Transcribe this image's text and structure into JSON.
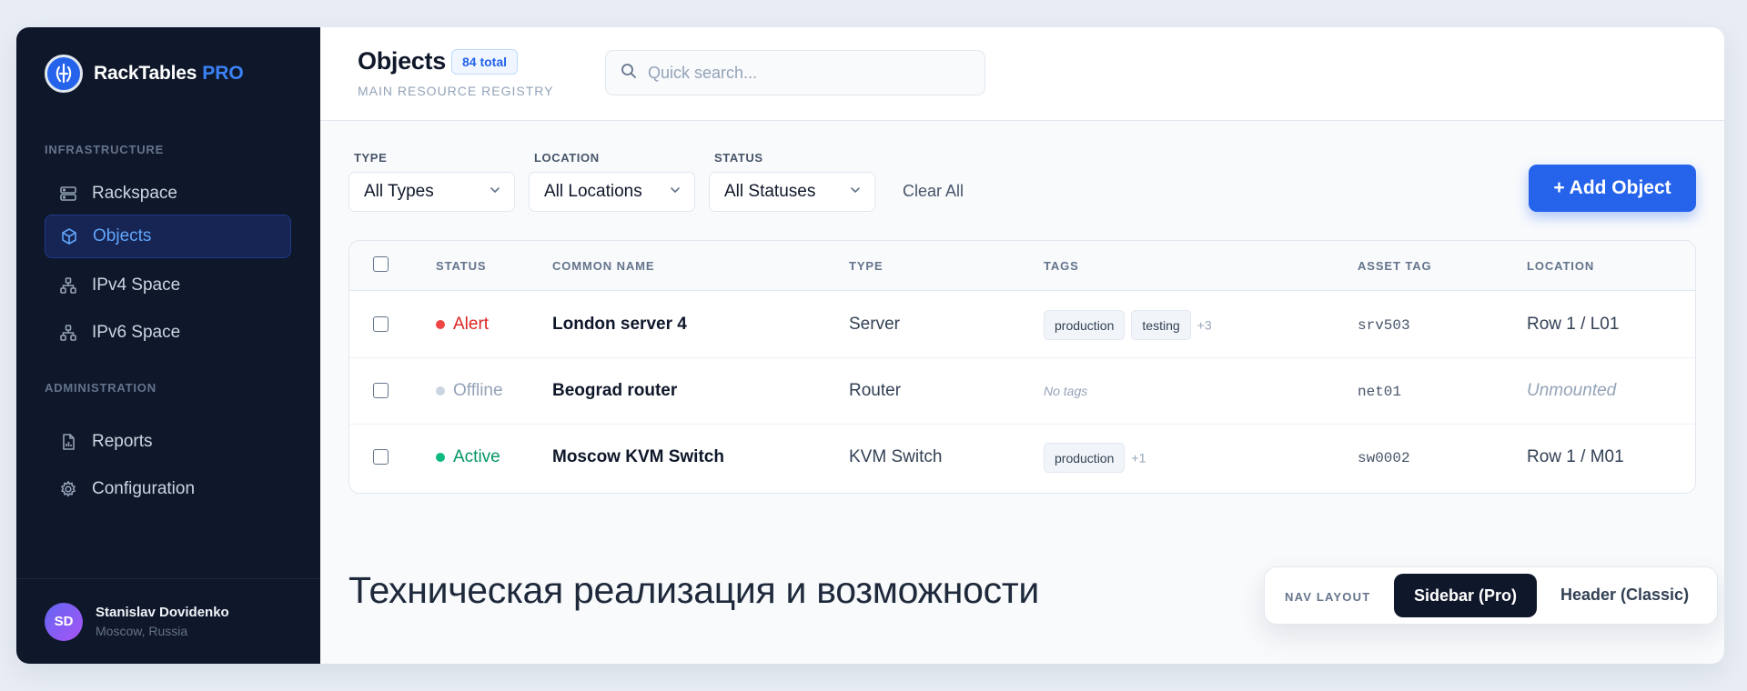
{
  "brand": {
    "name": "RackTables",
    "suffix": "PRO"
  },
  "sidebar": {
    "sections": [
      {
        "title": "INFRASTRUCTURE"
      },
      {
        "title": "ADMINISTRATION"
      }
    ],
    "items": [
      {
        "label": "Rackspace",
        "icon": "server-icon",
        "active": false
      },
      {
        "label": "Objects",
        "icon": "cube-icon",
        "active": true
      },
      {
        "label": "IPv4 Space",
        "icon": "network-icon",
        "active": false
      },
      {
        "label": "IPv6 Space",
        "icon": "network-icon",
        "active": false
      },
      {
        "label": "Reports",
        "icon": "report-icon",
        "active": false
      },
      {
        "label": "Configuration",
        "icon": "gear-icon",
        "active": false
      }
    ],
    "user": {
      "initials": "SD",
      "name": "Stanislav Dovidenko",
      "location": "Moscow, Russia"
    }
  },
  "header": {
    "title": "Objects",
    "count_badge": "84 total",
    "subtitle": "MAIN RESOURCE REGISTRY",
    "search_placeholder": "Quick search..."
  },
  "filters": {
    "type": {
      "label": "TYPE",
      "value": "All Types"
    },
    "location": {
      "label": "LOCATION",
      "value": "All Locations"
    },
    "status": {
      "label": "STATUS",
      "value": "All Statuses"
    },
    "clear_label": "Clear All"
  },
  "add_button_label": "+ Add Object",
  "table": {
    "columns": [
      "STATUS",
      "COMMON NAME",
      "TYPE",
      "TAGS",
      "ASSET TAG",
      "LOCATION"
    ],
    "rows": [
      {
        "status": "Alert",
        "status_color": "#ef4444",
        "status_text_color": "#dc2626",
        "name": "London server 4",
        "type": "Server",
        "tags": [
          "production",
          "testing"
        ],
        "more_tags": "+3",
        "asset_tag": "srv503",
        "location": "Row 1 / L01",
        "location_mounted": true
      },
      {
        "status": "Offline",
        "status_color": "#cbd5e1",
        "status_text_color": "#94a3b8",
        "name": "Beograd router",
        "type": "Router",
        "tags": [],
        "no_tags_text": "No tags",
        "asset_tag": "net01",
        "location": "Unmounted",
        "location_mounted": false
      },
      {
        "status": "Active",
        "status_color": "#10b981",
        "status_text_color": "#059669",
        "name": "Moscow KVM Switch",
        "type": "KVM Switch",
        "tags": [
          "production"
        ],
        "more_tags": "+1",
        "asset_tag": "sw0002",
        "location": "Row 1 / M01",
        "location_mounted": true
      }
    ]
  },
  "section_heading": "Техническая реализация и возможности",
  "nav_layout": {
    "label": "NAV LAYOUT",
    "options": [
      "Sidebar (Pro)",
      "Header (Classic)"
    ],
    "selected": "Sidebar (Pro)"
  },
  "colors": {
    "accent": "#2563eb",
    "sidebar_bg": "#0f172a"
  }
}
